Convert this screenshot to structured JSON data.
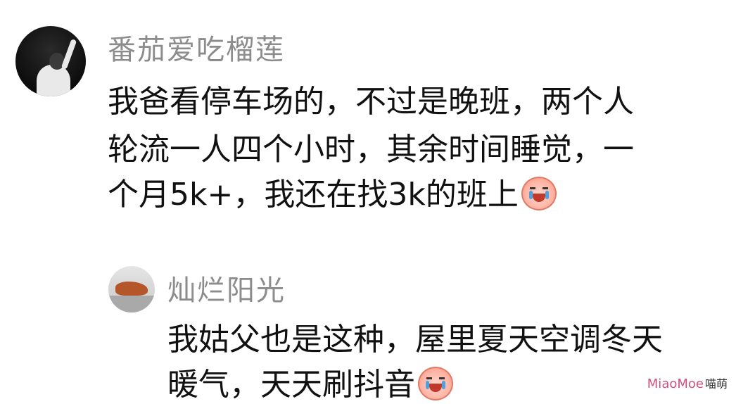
{
  "comment": {
    "username": "番茄爱吃榴莲",
    "avatar_icon": "person-pointing-up-avatar",
    "lines": [
      "我爸看停车场的，不过是晚班，两个人",
      "轮流一人四个小时，其余时间睡觉，一",
      "个月5k+，我还在找3k的班上"
    ],
    "emoji": "crying-face-icon"
  },
  "reply": {
    "username": "灿烂阳光",
    "avatar_icon": "dog-lying-avatar",
    "lines": [
      "我姑父也是这种，屋里夏天空调冬天",
      "暖气，天天刷抖音"
    ],
    "emoji": "crying-face-icon"
  },
  "watermark": {
    "text": "MiaoMoe",
    "cn": "喵萌"
  }
}
